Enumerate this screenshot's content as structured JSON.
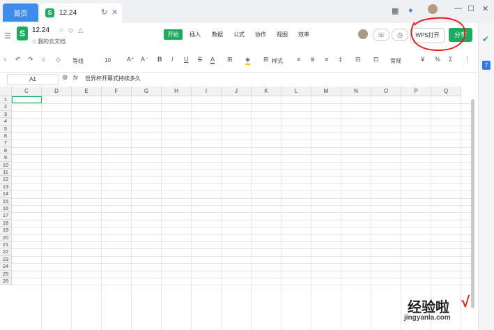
{
  "tabs": {
    "home": "首页",
    "doc": "12.24"
  },
  "document": {
    "title": "12.24",
    "location": "我的云文档"
  },
  "menu": [
    "开始",
    "插入",
    "数据",
    "公式",
    "协作",
    "视图",
    "效率"
  ],
  "header_buttons": {
    "wps_open": "WPS打开",
    "share": "分享"
  },
  "toolbar": {
    "font": "等线",
    "size": "10",
    "style": "样式",
    "number_format": "常规"
  },
  "formula_bar": {
    "cell_ref": "A1",
    "fx": "fx",
    "content": "世界杯开幕式持续多久"
  },
  "columns": [
    "C",
    "D",
    "E",
    "F",
    "G",
    "H",
    "I",
    "J",
    "K",
    "L",
    "M",
    "N",
    "O",
    "P",
    "Q"
  ],
  "rows": [
    "1",
    "2",
    "3",
    "4",
    "5",
    "6",
    "7",
    "8",
    "9",
    "10",
    "11",
    "12",
    "13",
    "14",
    "15",
    "16",
    "17",
    "18",
    "19",
    "20",
    "21",
    "22",
    "23",
    "24",
    "25",
    "26"
  ],
  "watermark": {
    "text": "经验啦",
    "url": "jingyanla.com"
  },
  "colors": {
    "accent_green": "#1dab5f",
    "home_tab_blue": "#3f8cf0",
    "annotation_red": "#e02020"
  }
}
